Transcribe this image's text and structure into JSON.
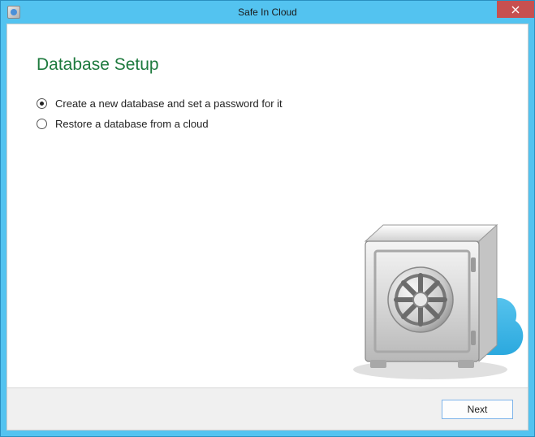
{
  "window": {
    "title": "Safe In Cloud"
  },
  "page": {
    "heading": "Database Setup"
  },
  "options": [
    {
      "label": "Create a new database and set a password for it",
      "selected": true
    },
    {
      "label": "Restore a database from a cloud",
      "selected": false
    }
  ],
  "footer": {
    "next_label": "Next"
  },
  "icons": {
    "close": "close-icon",
    "app": "app-icon",
    "safe": "safe-cloud-illustration"
  }
}
